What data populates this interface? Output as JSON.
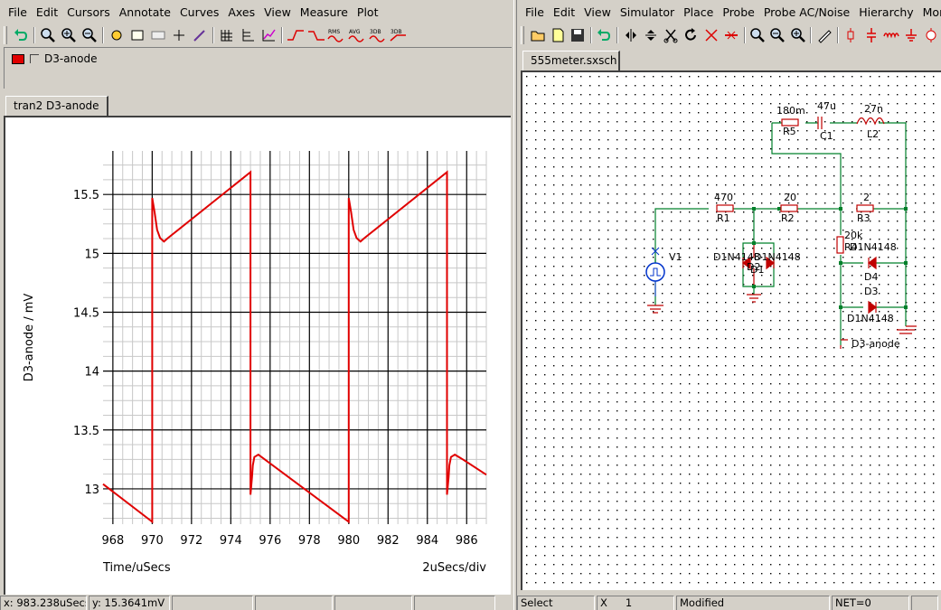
{
  "waveform": {
    "menu": [
      "File",
      "Edit",
      "Cursors",
      "Annotate",
      "Curves",
      "Axes",
      "View",
      "Measure",
      "Plot"
    ],
    "toolbar_labels": [
      "RMS",
      "AVG",
      "3DB",
      "3DB"
    ],
    "legend": {
      "curve_name": "D3-anode",
      "color": "#e00000"
    },
    "tab": "tran2 D3-anode",
    "status": {
      "x": "x: 983.238uSecs",
      "y": "y: 15.3641mV"
    }
  },
  "chart_data": {
    "type": "line",
    "xlabel": "Time/uSecs",
    "ylabel": "D3-anode / mV",
    "x_scale_note": "2uSecs/div",
    "xlim": [
      967.5,
      987
    ],
    "ylim": [
      12.7,
      15.87
    ],
    "x_ticks": [
      968,
      970,
      972,
      974,
      976,
      978,
      980,
      982,
      984,
      986
    ],
    "y_ticks": [
      13,
      13.5,
      14,
      14.5,
      15,
      15.5
    ],
    "grid": true,
    "series": [
      {
        "color": "#e00000",
        "x": [
          967.5,
          970.0,
          970.0,
          970.12,
          970.25,
          970.4,
          970.6,
          970.8,
          975.0,
          975.0,
          975.08,
          975.12,
          975.2,
          975.4,
          980.0,
          980.0,
          980.12,
          980.25,
          980.4,
          980.6,
          980.8,
          985.0,
          985.0,
          985.08,
          985.12,
          985.2,
          985.4,
          985.8,
          987.0
        ],
        "y": [
          13.04,
          12.72,
          15.47,
          15.35,
          15.2,
          15.13,
          15.1,
          15.13,
          15.69,
          12.95,
          13.1,
          13.2,
          13.27,
          13.29,
          12.72,
          15.47,
          15.35,
          15.2,
          15.13,
          15.1,
          15.13,
          15.69,
          12.95,
          13.1,
          13.2,
          13.27,
          13.29,
          13.25,
          13.12
        ]
      }
    ]
  },
  "schematic": {
    "menu": [
      "File",
      "Edit",
      "View",
      "Simulator",
      "Place",
      "Probe",
      "Probe AC/Noise",
      "Hierarchy",
      "Monte-C"
    ],
    "tab": "555meter.sxsch",
    "labels": {
      "r5_value": "180m",
      "r5_name": "R5",
      "c1_value": "47u",
      "c1_name": "C1",
      "l2_value": "27n",
      "l2_name": "L2",
      "r1_value": "470",
      "r1_name": "R1",
      "r2_value": "20",
      "r2_name": "R2",
      "r3_value": "2",
      "r3_name": "R3",
      "r4_value": "20k",
      "r4_name": "R4",
      "v1_name": "V1",
      "d1_model": "D1N4148",
      "d1_name": "D1",
      "d2_model": "D1N4148",
      "d2_name": "D2",
      "d4_model": "D1N4148",
      "d4_name": "D4",
      "d3_name": "D3",
      "d3_model": "D1N4148",
      "probe_label": "D3-anode"
    },
    "status": {
      "mode": "Select",
      "x_label": "X",
      "x_value": "1",
      "state": "Modified",
      "net": "NET=0"
    }
  }
}
